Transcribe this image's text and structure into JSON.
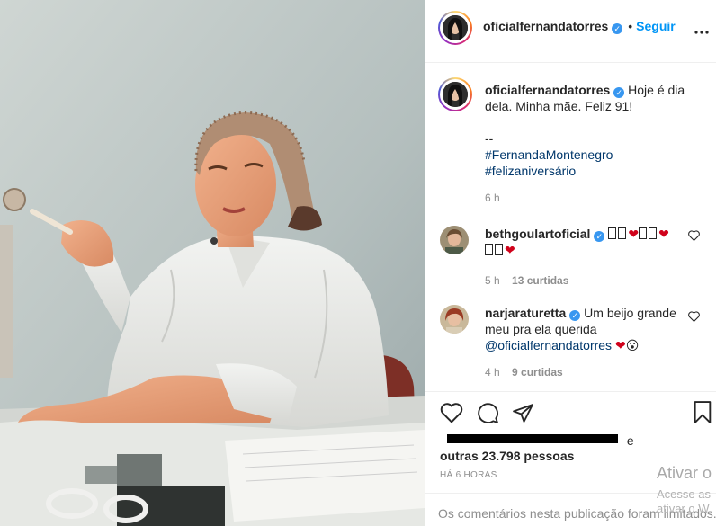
{
  "post": {
    "username": "oficialfernandatorres",
    "follow_label": "Seguir",
    "dot": "•",
    "more_label": "•••",
    "caption_line1": "Hoje é dia",
    "caption_line2": "dela. Minha mãe. Feliz 91!",
    "caption_sep": "--",
    "hashtag_1": "#FernandaMontenegro",
    "hashtag_2": "#felizaniversário",
    "caption_time": "6 h"
  },
  "comments": [
    {
      "username": "bethgoulartoficial",
      "time": "5 h",
      "likes": "13 curtidas"
    },
    {
      "username": "narjaraturetta",
      "text_line1": "Um beijo grande",
      "text_line2": "meu pra ela querida",
      "mention": "@oficialfernandatorres",
      "time": "4 h",
      "likes": "9 curtidas"
    }
  ],
  "likes": {
    "suffix": "e",
    "others": "outras 23.798 pessoas"
  },
  "posted_ago": "HÁ 6 HORAS",
  "comments_disabled": "Os comentários nesta publicação foram limitados.",
  "windows_watermark": {
    "title": "Ativar o",
    "subtitle": "Acesse as",
    "subtitle2": "ativar o W"
  },
  "icons": [
    "verified-badge",
    "heart-icon",
    "comment-icon",
    "share-icon",
    "bookmark-icon",
    "more-icon"
  ],
  "colors": {
    "link_blue": "#0095f6",
    "hashtag": "#00376b",
    "verified": "#3897f0",
    "muted": "#8e8e8e"
  }
}
